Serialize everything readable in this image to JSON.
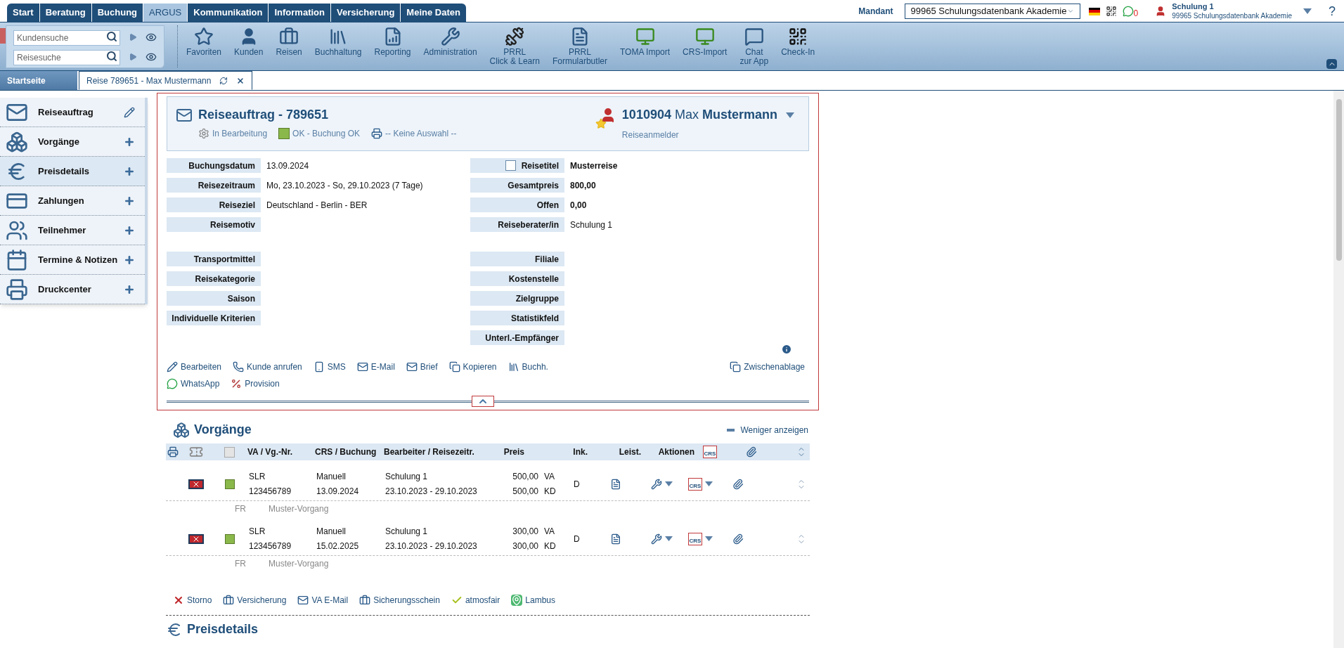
{
  "top_tabs": [
    {
      "label": "Start",
      "selected": false
    },
    {
      "label": "Beratung",
      "selected": false
    },
    {
      "label": "Buchung",
      "selected": false
    },
    {
      "label": "ARGUS",
      "selected": true
    },
    {
      "label": "Kommunikation",
      "selected": false
    },
    {
      "label": "Information",
      "selected": false
    },
    {
      "label": "Versicherung",
      "selected": false
    },
    {
      "label": "Meine Daten",
      "selected": false
    }
  ],
  "mandant": {
    "label": "Mandant",
    "value": "99965 Schulungsdatenbank Akademie"
  },
  "whatsapp_count": "0",
  "user": {
    "name": "Schulung 1",
    "subtitle": "99965 Schulungsdatenbank Akademie"
  },
  "help": "?",
  "searches": [
    {
      "placeholder": "Kundensuche"
    },
    {
      "placeholder": "Reisesuche"
    }
  ],
  "toolbar": [
    {
      "label": "Favoriten",
      "kind": "star"
    },
    {
      "label": "Kunden",
      "kind": "user"
    },
    {
      "label": "Reisen",
      "kind": "case"
    },
    {
      "label": "Buchhaltung",
      "kind": "binders"
    },
    {
      "label": "Reporting",
      "kind": "report"
    },
    {
      "label": "Administration",
      "kind": "tools"
    },
    {
      "label": "PRRL\nClick & Learn",
      "kind": "fitness"
    },
    {
      "label": "PRRL\nFormularbutler",
      "kind": "paragraph"
    },
    {
      "label": "TOMA Import",
      "kind": "monitor"
    },
    {
      "label": "CRS-Import",
      "kind": "monitor"
    },
    {
      "label": "Chat\nzur App",
      "kind": "chat"
    },
    {
      "label": "Check-In",
      "kind": "qr"
    }
  ],
  "doc_tabs": [
    {
      "label": "Startseite",
      "selected": false,
      "closable": false
    },
    {
      "label": "Reise 789651 - Max Mustermann",
      "selected": true,
      "closable": true
    }
  ],
  "sidebar": [
    {
      "label": "Reiseauftrag",
      "kind": "mail",
      "editable": true,
      "selected": false
    },
    {
      "label": "Vorgänge",
      "kind": "boxes",
      "editable": false,
      "selected": false
    },
    {
      "label": "Preisdetails",
      "kind": "euro",
      "editable": false,
      "selected": true
    },
    {
      "label": "Zahlungen",
      "kind": "card",
      "editable": false,
      "selected": false
    },
    {
      "label": "Teilnehmer",
      "kind": "users",
      "editable": false,
      "selected": false
    },
    {
      "label": "Termine & Notizen",
      "kind": "calendar",
      "editable": false,
      "selected": false
    },
    {
      "label": "Druckcenter",
      "kind": "printer",
      "editable": false,
      "selected": false
    }
  ],
  "order": {
    "title": "Reiseauftrag - 789651",
    "statuses": [
      {
        "label": "In Bearbeitung",
        "kind": "gear"
      },
      {
        "label": "OK - Buchung OK",
        "kind": "ok"
      },
      {
        "label": "-- Keine Auswahl --",
        "kind": "printer"
      }
    ],
    "customer": {
      "number": "1010904",
      "first_name": "Max",
      "last_name": "Mustermann",
      "role": "Reiseanmelder"
    },
    "left_groups": [
      [
        {
          "label": "Buchungsdatum",
          "value": "13.09.2024"
        },
        {
          "label": "Reisezeitraum",
          "value": "Mo, 23.10.2023 - So, 29.10.2023 (7 Tage)"
        },
        {
          "label": "Reiseziel",
          "value": "Deutschland - Berlin - BER"
        },
        {
          "label": "Reisemotiv"
        }
      ],
      [
        {
          "label": "Transportmittel"
        },
        {
          "label": "Reisekategorie"
        },
        {
          "label": "Saison"
        },
        {
          "label": "Individuelle Kriterien"
        }
      ]
    ],
    "right_groups": [
      [
        {
          "label": "Reisetitel",
          "value": "Musterreise",
          "bold": true,
          "checked": false
        },
        {
          "label": "Gesamtpreis",
          "value": "800,00",
          "bold": true
        },
        {
          "label": "Offen",
          "value": "0,00",
          "bold": true
        },
        {
          "label": "Reiseberater/in",
          "value": "Schulung 1",
          "bold": false
        }
      ],
      [
        {
          "label": "Filiale"
        },
        {
          "label": "Kostenstelle"
        },
        {
          "label": "Zielgruppe"
        },
        {
          "label": "Statistikfeld"
        },
        {
          "label": "Unterl.-Empfänger"
        }
      ]
    ],
    "actions": [
      [
        {
          "label": "Bearbeiten",
          "kind": "edit"
        },
        {
          "label": "Kunde anrufen",
          "kind": "phone"
        },
        {
          "label": "SMS",
          "kind": "sms"
        },
        {
          "label": "E-Mail",
          "kind": "mail"
        },
        {
          "label": "Brief",
          "kind": "mail"
        },
        {
          "label": "Kopieren",
          "kind": "copy"
        },
        {
          "label": "Buchh.",
          "kind": "binders"
        }
      ],
      [
        {
          "label": "WhatsApp",
          "kind": "whatsapp"
        },
        {
          "label": "Provision",
          "kind": "provision"
        }
      ]
    ],
    "clipboard": "Zwischenablage"
  },
  "vorgaenge": {
    "title": "Vorgänge",
    "toggle": "Weniger anzeigen",
    "select_all_checked": false,
    "header_crs": "CRS",
    "columns": [
      "VA / Vg.-Nr.",
      "CRS / Buchung",
      "Bearbeiter / Reisezeitr.",
      "Preis",
      "Ink.",
      "Leist.",
      "Aktionen"
    ],
    "rows": [
      {
        "va": "SLR",
        "number": "123456789",
        "crs": "Manuell",
        "date": "13.09.2024",
        "agent": "Schulung 1",
        "period": "23.10.2023 - 29.10.2023",
        "prices": [
          {
            "amount": "500,00",
            "type": "VA"
          },
          {
            "amount": "500,00",
            "type": "KD"
          }
        ],
        "ink": "D",
        "crs_icon": "CRS",
        "note_code": "FR",
        "note": "Muster-Vorgang"
      },
      {
        "va": "SLR",
        "number": "123456789",
        "crs": "Manuell",
        "date": "15.02.2025",
        "agent": "Schulung 1",
        "period": "23.10.2023 - 29.10.2023",
        "prices": [
          {
            "amount": "300,00",
            "type": "VA"
          },
          {
            "amount": "300,00",
            "type": "KD"
          }
        ],
        "ink": "D",
        "crs_icon": "CRS",
        "note_code": "FR",
        "note": "Muster-Vorgang"
      }
    ],
    "footer_actions": [
      {
        "label": "Storno",
        "kind": "cancel"
      },
      {
        "label": "Versicherung",
        "kind": "case"
      },
      {
        "label": "VA E-Mail",
        "kind": "mail"
      },
      {
        "label": "Sicherungsschein",
        "kind": "case"
      },
      {
        "label": "atmosfair",
        "kind": "check"
      },
      {
        "label": "Lambus",
        "kind": "lambus"
      }
    ]
  },
  "next_section": "Preisdetails"
}
